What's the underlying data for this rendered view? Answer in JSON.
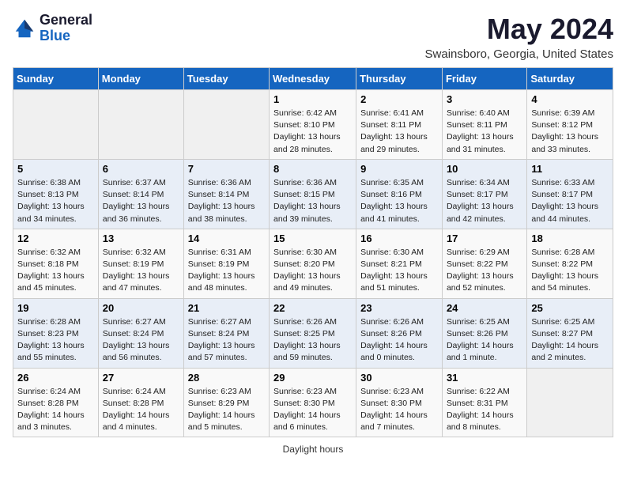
{
  "header": {
    "logo_general": "General",
    "logo_blue": "Blue",
    "month_title": "May 2024",
    "location": "Swainsboro, Georgia, United States"
  },
  "days_of_week": [
    "Sunday",
    "Monday",
    "Tuesday",
    "Wednesday",
    "Thursday",
    "Friday",
    "Saturday"
  ],
  "weeks": [
    [
      {
        "day": "",
        "info": ""
      },
      {
        "day": "",
        "info": ""
      },
      {
        "day": "",
        "info": ""
      },
      {
        "day": "1",
        "info": "Sunrise: 6:42 AM\nSunset: 8:10 PM\nDaylight: 13 hours and 28 minutes."
      },
      {
        "day": "2",
        "info": "Sunrise: 6:41 AM\nSunset: 8:11 PM\nDaylight: 13 hours and 29 minutes."
      },
      {
        "day": "3",
        "info": "Sunrise: 6:40 AM\nSunset: 8:11 PM\nDaylight: 13 hours and 31 minutes."
      },
      {
        "day": "4",
        "info": "Sunrise: 6:39 AM\nSunset: 8:12 PM\nDaylight: 13 hours and 33 minutes."
      }
    ],
    [
      {
        "day": "5",
        "info": "Sunrise: 6:38 AM\nSunset: 8:13 PM\nDaylight: 13 hours and 34 minutes."
      },
      {
        "day": "6",
        "info": "Sunrise: 6:37 AM\nSunset: 8:14 PM\nDaylight: 13 hours and 36 minutes."
      },
      {
        "day": "7",
        "info": "Sunrise: 6:36 AM\nSunset: 8:14 PM\nDaylight: 13 hours and 38 minutes."
      },
      {
        "day": "8",
        "info": "Sunrise: 6:36 AM\nSunset: 8:15 PM\nDaylight: 13 hours and 39 minutes."
      },
      {
        "day": "9",
        "info": "Sunrise: 6:35 AM\nSunset: 8:16 PM\nDaylight: 13 hours and 41 minutes."
      },
      {
        "day": "10",
        "info": "Sunrise: 6:34 AM\nSunset: 8:17 PM\nDaylight: 13 hours and 42 minutes."
      },
      {
        "day": "11",
        "info": "Sunrise: 6:33 AM\nSunset: 8:17 PM\nDaylight: 13 hours and 44 minutes."
      }
    ],
    [
      {
        "day": "12",
        "info": "Sunrise: 6:32 AM\nSunset: 8:18 PM\nDaylight: 13 hours and 45 minutes."
      },
      {
        "day": "13",
        "info": "Sunrise: 6:32 AM\nSunset: 8:19 PM\nDaylight: 13 hours and 47 minutes."
      },
      {
        "day": "14",
        "info": "Sunrise: 6:31 AM\nSunset: 8:19 PM\nDaylight: 13 hours and 48 minutes."
      },
      {
        "day": "15",
        "info": "Sunrise: 6:30 AM\nSunset: 8:20 PM\nDaylight: 13 hours and 49 minutes."
      },
      {
        "day": "16",
        "info": "Sunrise: 6:30 AM\nSunset: 8:21 PM\nDaylight: 13 hours and 51 minutes."
      },
      {
        "day": "17",
        "info": "Sunrise: 6:29 AM\nSunset: 8:22 PM\nDaylight: 13 hours and 52 minutes."
      },
      {
        "day": "18",
        "info": "Sunrise: 6:28 AM\nSunset: 8:22 PM\nDaylight: 13 hours and 54 minutes."
      }
    ],
    [
      {
        "day": "19",
        "info": "Sunrise: 6:28 AM\nSunset: 8:23 PM\nDaylight: 13 hours and 55 minutes."
      },
      {
        "day": "20",
        "info": "Sunrise: 6:27 AM\nSunset: 8:24 PM\nDaylight: 13 hours and 56 minutes."
      },
      {
        "day": "21",
        "info": "Sunrise: 6:27 AM\nSunset: 8:24 PM\nDaylight: 13 hours and 57 minutes."
      },
      {
        "day": "22",
        "info": "Sunrise: 6:26 AM\nSunset: 8:25 PM\nDaylight: 13 hours and 59 minutes."
      },
      {
        "day": "23",
        "info": "Sunrise: 6:26 AM\nSunset: 8:26 PM\nDaylight: 14 hours and 0 minutes."
      },
      {
        "day": "24",
        "info": "Sunrise: 6:25 AM\nSunset: 8:26 PM\nDaylight: 14 hours and 1 minute."
      },
      {
        "day": "25",
        "info": "Sunrise: 6:25 AM\nSunset: 8:27 PM\nDaylight: 14 hours and 2 minutes."
      }
    ],
    [
      {
        "day": "26",
        "info": "Sunrise: 6:24 AM\nSunset: 8:28 PM\nDaylight: 14 hours and 3 minutes."
      },
      {
        "day": "27",
        "info": "Sunrise: 6:24 AM\nSunset: 8:28 PM\nDaylight: 14 hours and 4 minutes."
      },
      {
        "day": "28",
        "info": "Sunrise: 6:23 AM\nSunset: 8:29 PM\nDaylight: 14 hours and 5 minutes."
      },
      {
        "day": "29",
        "info": "Sunrise: 6:23 AM\nSunset: 8:30 PM\nDaylight: 14 hours and 6 minutes."
      },
      {
        "day": "30",
        "info": "Sunrise: 6:23 AM\nSunset: 8:30 PM\nDaylight: 14 hours and 7 minutes."
      },
      {
        "day": "31",
        "info": "Sunrise: 6:22 AM\nSunset: 8:31 PM\nDaylight: 14 hours and 8 minutes."
      },
      {
        "day": "",
        "info": ""
      }
    ]
  ],
  "footer": {
    "daylight_hours_label": "Daylight hours"
  }
}
